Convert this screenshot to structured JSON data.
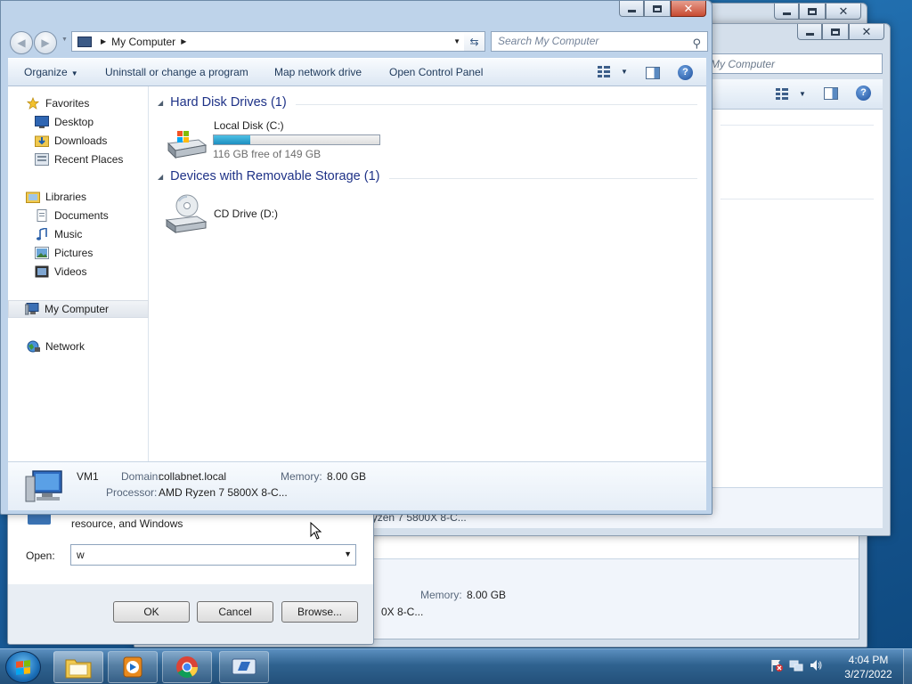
{
  "explorer": {
    "address_crumb": "My Computer",
    "search_placeholder": "Search My Computer",
    "commands": {
      "organize": "Organize",
      "uninstall": "Uninstall or change a program",
      "map_drive": "Map network drive",
      "control_panel": "Open Control Panel"
    },
    "nav": {
      "favorites": "Favorites",
      "desktop": "Desktop",
      "downloads": "Downloads",
      "recent": "Recent Places",
      "libraries": "Libraries",
      "documents": "Documents",
      "music": "Music",
      "pictures": "Pictures",
      "videos": "Videos",
      "computer": "My Computer",
      "network": "Network"
    },
    "groups": {
      "hdd_header": "Hard Disk Drives (1)",
      "removable_header": "Devices with Removable Storage (1)"
    },
    "local_disk": {
      "name": "Local Disk (C:)",
      "free_text": "116 GB free of 149 GB",
      "used_fraction": 0.22
    },
    "cd_drive": {
      "name": "CD Drive (D:)"
    },
    "details": {
      "computer_name": "VM1",
      "domain_label": "Domain:",
      "domain_value": "collabnet.local",
      "memory_label": "Memory:",
      "memory_value": "8.00 GB",
      "processor_label": "Processor:",
      "processor_value": "AMD Ryzen 7 5800X 8-C..."
    }
  },
  "back_window_1": {
    "search_placeholder": "My Computer",
    "details_text": "Processor: AMD Ryzen 7 5800X 8-C..."
  },
  "back_window_2": {
    "memory_label": "Memory:",
    "memory_value": "8.00 GB",
    "processor_value": "0X 8-C..."
  },
  "run_dialog": {
    "description": "resource, and Windows",
    "open_label": "Open:",
    "open_value": "w",
    "ok": "OK",
    "cancel": "Cancel",
    "browse": "Browse..."
  },
  "taskbar": {
    "time": "4:04 PM",
    "date": "3/27/2022"
  },
  "colors": {
    "accent": "#1e3287",
    "disk_fill": "#1d8fc0",
    "close_button": "#c84b32"
  }
}
